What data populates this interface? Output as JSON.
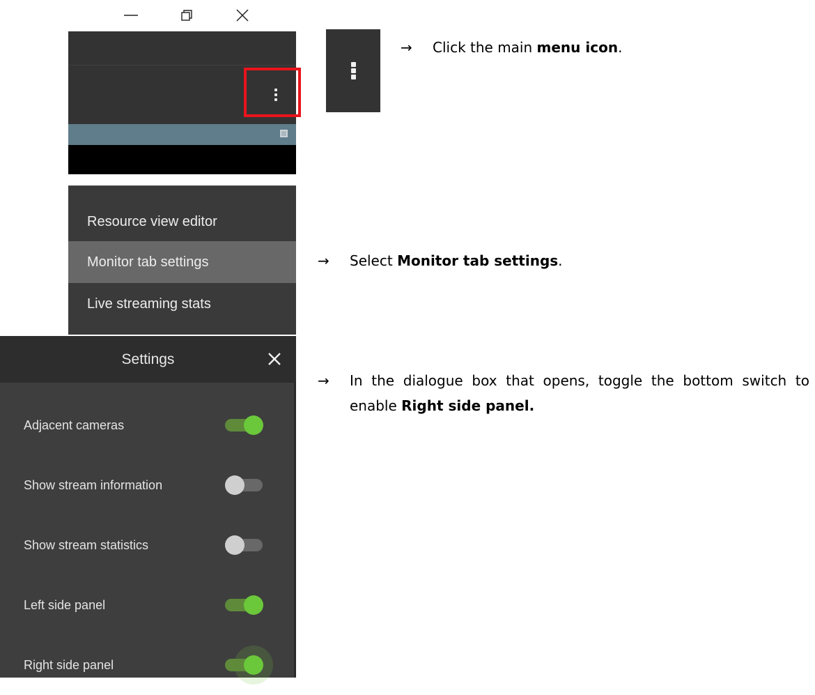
{
  "window_controls": {
    "minimize_icon": "minimize-icon",
    "restore_icon": "restore-icon",
    "close_icon": "close-icon"
  },
  "step1": {
    "menu_icon": "vertical-dots-menu-icon",
    "highlight_color": "#e8141c",
    "instruction": {
      "arrow": "→",
      "before": "Click the main ",
      "bold": "menu icon",
      "after": "."
    }
  },
  "step2": {
    "menu_items": [
      {
        "label": "Resource view editor",
        "highlighted": false
      },
      {
        "label": "Monitor tab settings",
        "highlighted": true
      },
      {
        "label": "Live streaming stats",
        "highlighted": false
      }
    ],
    "instruction": {
      "arrow": "→",
      "before": "Select ",
      "bold": "Monitor tab settings",
      "after": "."
    }
  },
  "step3": {
    "dialog": {
      "title": "Settings",
      "close_icon": "close-icon",
      "settings": [
        {
          "label": "Adjacent cameras",
          "enabled": true
        },
        {
          "label": "Show stream information",
          "enabled": false
        },
        {
          "label": "Show stream statistics",
          "enabled": false
        },
        {
          "label": "Left side panel",
          "enabled": true
        },
        {
          "label": "Right side panel",
          "enabled": true
        }
      ],
      "toggle_on_color": "#6bc83a",
      "toggle_off_color": "#cfcfcf"
    },
    "instruction": {
      "arrow": "→",
      "before": "In the dialogue box that opens, toggle the bottom switch to enable ",
      "bold": "Right side panel.",
      "after": ""
    }
  }
}
